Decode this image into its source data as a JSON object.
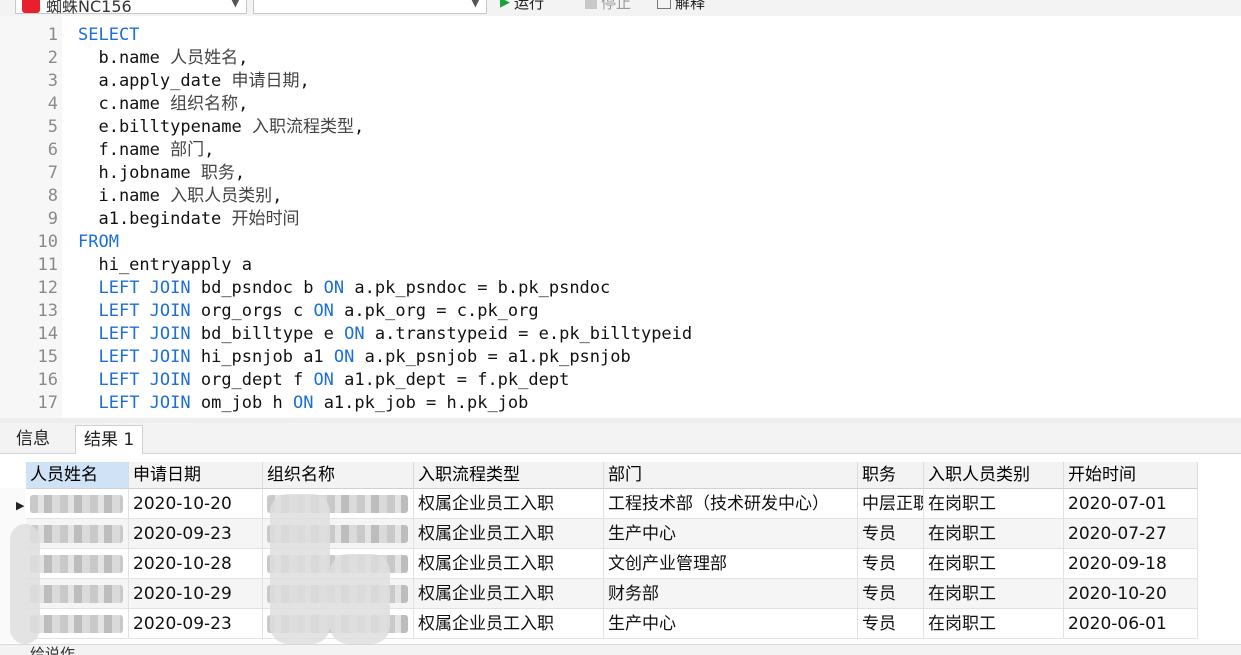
{
  "toolbar": {
    "connection_name": "蜘蛛NC156",
    "database_value": "",
    "run_label": "运行",
    "stop_label": "停止",
    "explain_label": "解释"
  },
  "editor": {
    "lines": [
      {
        "n": "1",
        "parts": [
          {
            "t": "SELECT",
            "k": "kw"
          }
        ]
      },
      {
        "n": "2",
        "parts": [
          {
            "t": "  b.name ",
            "k": ""
          },
          {
            "t": "人员姓名",
            "k": "zh"
          },
          {
            "t": ",",
            "k": ""
          }
        ]
      },
      {
        "n": "3",
        "parts": [
          {
            "t": "  a.apply_date ",
            "k": ""
          },
          {
            "t": "申请日期",
            "k": "zh"
          },
          {
            "t": ",",
            "k": ""
          }
        ]
      },
      {
        "n": "4",
        "parts": [
          {
            "t": "  c.name ",
            "k": ""
          },
          {
            "t": "组织名称",
            "k": "zh"
          },
          {
            "t": ",",
            "k": ""
          }
        ]
      },
      {
        "n": "5",
        "parts": [
          {
            "t": "  e.billtypename ",
            "k": ""
          },
          {
            "t": "入职流程类型",
            "k": "zh"
          },
          {
            "t": ",",
            "k": ""
          }
        ]
      },
      {
        "n": "6",
        "parts": [
          {
            "t": "  f.name ",
            "k": ""
          },
          {
            "t": "部门",
            "k": "zh"
          },
          {
            "t": ",",
            "k": ""
          }
        ]
      },
      {
        "n": "7",
        "parts": [
          {
            "t": "  h.jobname ",
            "k": ""
          },
          {
            "t": "职务",
            "k": "zh"
          },
          {
            "t": ",",
            "k": ""
          }
        ]
      },
      {
        "n": "8",
        "parts": [
          {
            "t": "  i.name ",
            "k": ""
          },
          {
            "t": "入职人员类别",
            "k": "zh"
          },
          {
            "t": ",",
            "k": ""
          }
        ]
      },
      {
        "n": "9",
        "parts": [
          {
            "t": "  a1.begindate ",
            "k": ""
          },
          {
            "t": "开始时间",
            "k": "zh"
          }
        ]
      },
      {
        "n": "10",
        "parts": [
          {
            "t": "FROM",
            "k": "kw"
          }
        ]
      },
      {
        "n": "11",
        "parts": [
          {
            "t": "  hi_entryapply a",
            "k": ""
          }
        ]
      },
      {
        "n": "12",
        "parts": [
          {
            "t": "  ",
            "k": ""
          },
          {
            "t": "LEFT JOIN",
            "k": "kw"
          },
          {
            "t": " bd_psndoc b ",
            "k": ""
          },
          {
            "t": "ON",
            "k": "kw"
          },
          {
            "t": " a.pk_psndoc = b.pk_psndoc",
            "k": ""
          }
        ]
      },
      {
        "n": "13",
        "parts": [
          {
            "t": "  ",
            "k": ""
          },
          {
            "t": "LEFT JOIN",
            "k": "kw"
          },
          {
            "t": " org_orgs c ",
            "k": ""
          },
          {
            "t": "ON",
            "k": "kw"
          },
          {
            "t": " a.pk_org = c.pk_org",
            "k": ""
          }
        ]
      },
      {
        "n": "14",
        "parts": [
          {
            "t": "  ",
            "k": ""
          },
          {
            "t": "LEFT JOIN",
            "k": "kw"
          },
          {
            "t": " bd_billtype e ",
            "k": ""
          },
          {
            "t": "ON",
            "k": "kw"
          },
          {
            "t": " a.transtypeid = e.pk_billtypeid",
            "k": ""
          }
        ]
      },
      {
        "n": "15",
        "parts": [
          {
            "t": "  ",
            "k": ""
          },
          {
            "t": "LEFT JOIN",
            "k": "kw"
          },
          {
            "t": " hi_psnjob a1 ",
            "k": ""
          },
          {
            "t": "ON",
            "k": "kw"
          },
          {
            "t": " a.pk_psnjob = a1.pk_psnjob",
            "k": ""
          }
        ]
      },
      {
        "n": "16",
        "parts": [
          {
            "t": "  ",
            "k": ""
          },
          {
            "t": "LEFT JOIN",
            "k": "kw"
          },
          {
            "t": " org_dept f ",
            "k": ""
          },
          {
            "t": "ON",
            "k": "kw"
          },
          {
            "t": " a1.pk_dept = f.pk_dept",
            "k": ""
          }
        ]
      },
      {
        "n": "17",
        "parts": [
          {
            "t": "  ",
            "k": ""
          },
          {
            "t": "LEFT JOIN",
            "k": "kw"
          },
          {
            "t": " om_job h ",
            "k": ""
          },
          {
            "t": "ON",
            "k": "kw"
          },
          {
            "t": " a1.pk_job = h.pk_job",
            "k": ""
          }
        ]
      }
    ]
  },
  "tabs": [
    {
      "label": "信息",
      "active": false
    },
    {
      "label": "结果 1",
      "active": true
    }
  ],
  "grid": {
    "columns": [
      "人员姓名",
      "申请日期",
      "组织名称",
      "入职流程类型",
      "部门",
      "职务",
      "入职人员类别",
      "开始时间"
    ],
    "rows": [
      [
        "",
        "2020-10-20",
        "",
        "权属企业员工入职",
        "工程技术部（技术研发中心）",
        "中层正职",
        "在岗职工",
        "2020-07-01"
      ],
      [
        "",
        "2020-09-23",
        "",
        "权属企业员工入职",
        "生产中心",
        "专员",
        "在岗职工",
        "2020-07-27"
      ],
      [
        "",
        "2020-10-28",
        "",
        "权属企业员工入职",
        "文创产业管理部",
        "专员",
        "在岗职工",
        "2020-09-18"
      ],
      [
        "",
        "2020-10-29",
        "",
        "权属企业员工入职",
        "财务部",
        "专员",
        "在岗职工",
        "2020-10-20"
      ],
      [
        "",
        "2020-09-23",
        "",
        "权属企业员工入职",
        "生产中心",
        "专员",
        "在岗职工",
        "2020-06-01"
      ]
    ]
  },
  "status": {
    "text": "给说作"
  },
  "colors": {
    "keyword": "#1c6fd6",
    "run_icon": "#1aa13a",
    "selected_header": "#cfe2f6"
  }
}
